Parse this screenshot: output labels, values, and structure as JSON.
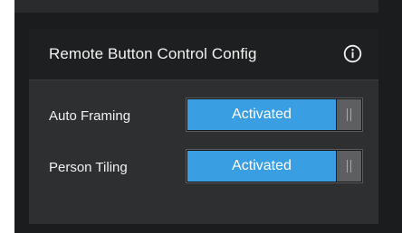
{
  "panel": {
    "title": "Remote Button Control Config",
    "info_icon": "info-circle-icon"
  },
  "settings": [
    {
      "label": "Auto Framing",
      "state": "Activated",
      "enabled": true
    },
    {
      "label": "Person Tiling",
      "state": "Activated",
      "enabled": true
    }
  ],
  "colors": {
    "accent": "#3a9ee2",
    "header_bg": "#1e1f20",
    "panel_bg": "#2e2f30",
    "text": "#f2f2f2"
  }
}
